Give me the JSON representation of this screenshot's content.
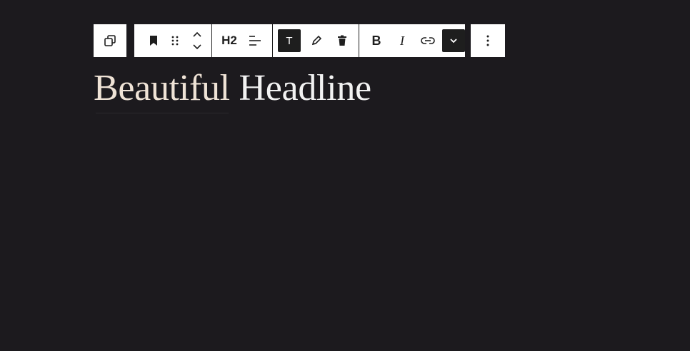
{
  "toolbar": {
    "transform_icon": "duplicate-icon",
    "heading_level": "H2",
    "text_style_glyph": "T",
    "bold": "B",
    "italic": "I"
  },
  "content": {
    "headline_word1": "Beautiful",
    "headline_word2": "Headline"
  },
  "colors": {
    "background": "#1c1a1e",
    "toolbar_bg": "#ffffff",
    "active_button": "#1e1e1e",
    "headline_accent": "#efe3d6",
    "headline_text": "#f2f2f2"
  }
}
